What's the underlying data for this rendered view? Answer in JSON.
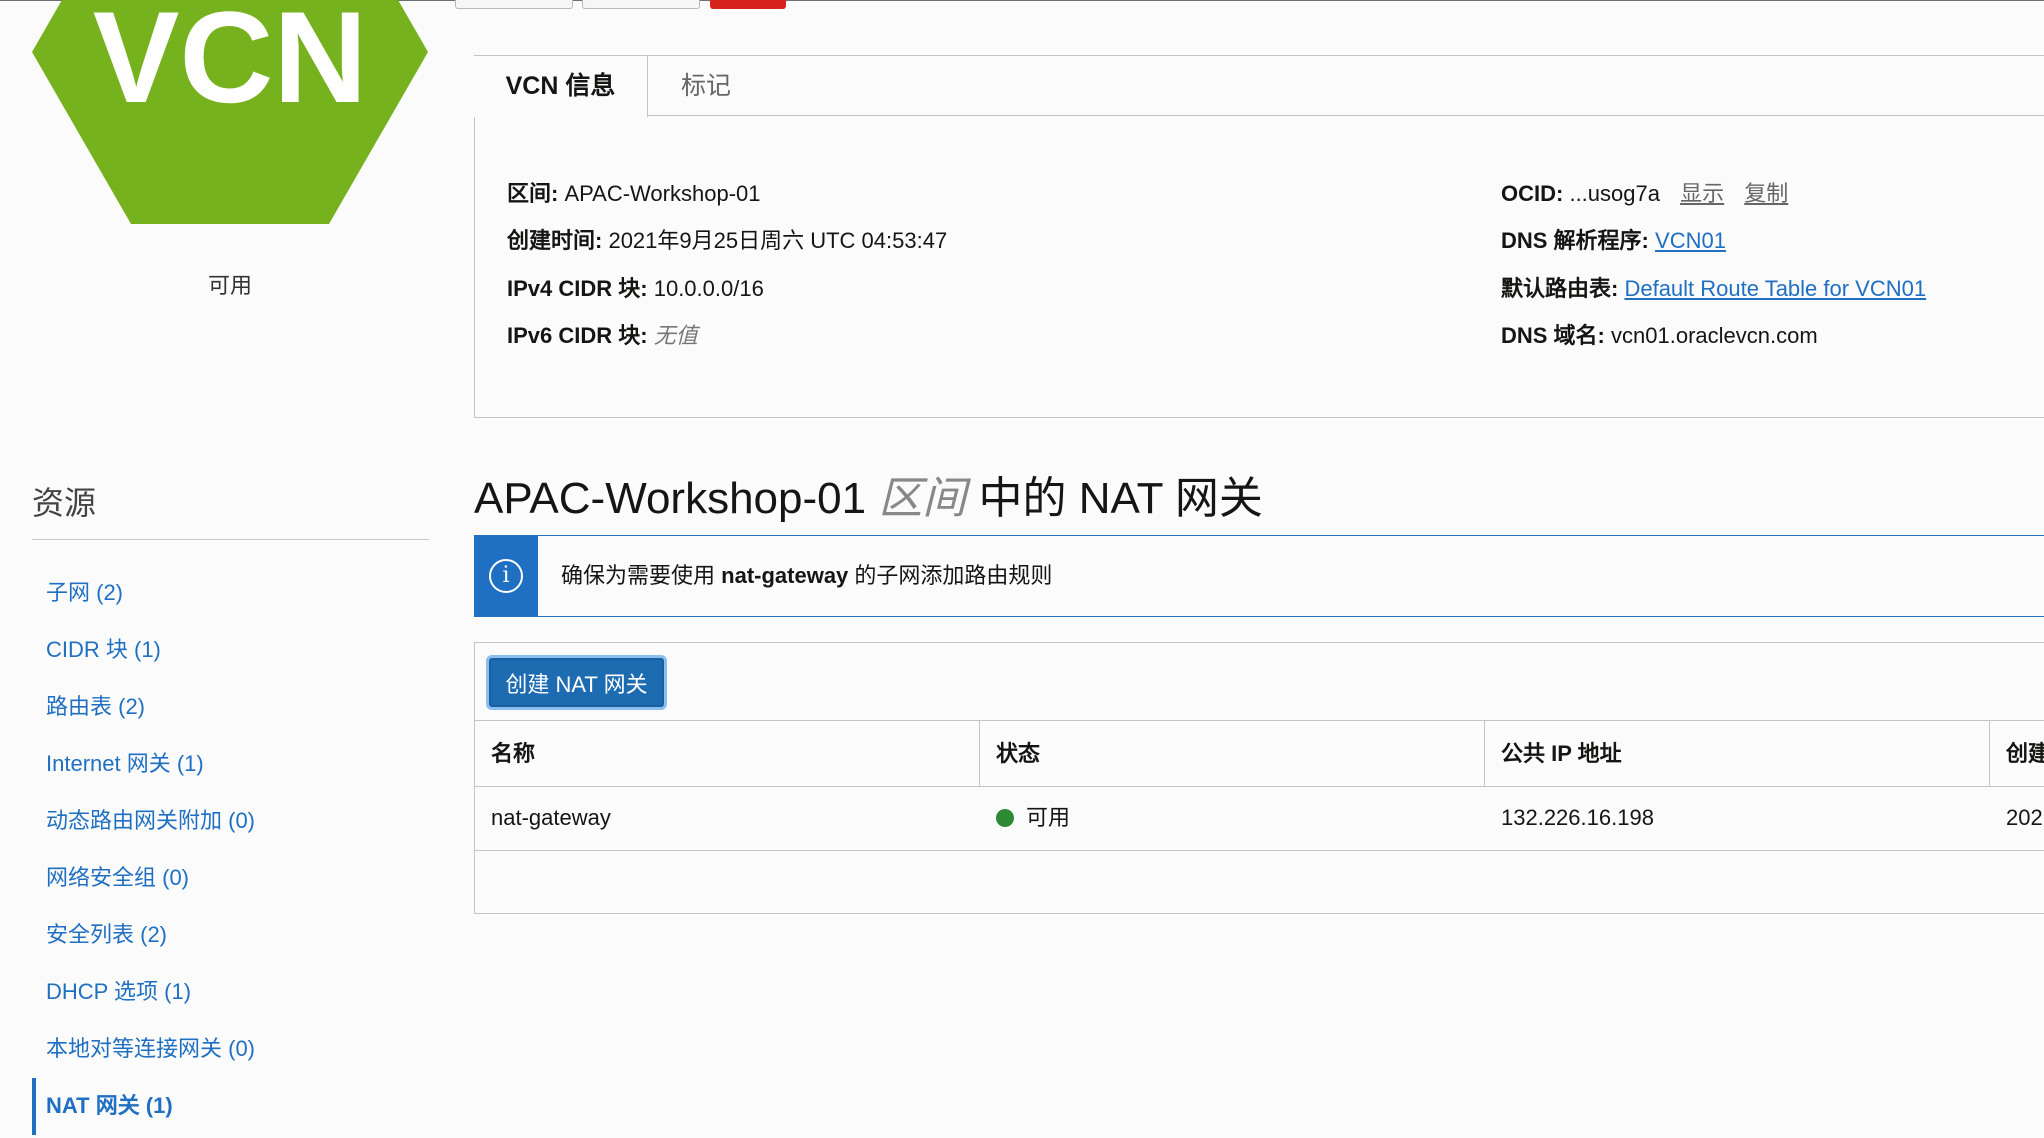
{
  "topbar": {
    "buttons": [
      "",
      "",
      ""
    ]
  },
  "vcn": {
    "icon_text": "VCN",
    "status": "可用",
    "colors": {
      "hex": "#76b21e",
      "accent": "#1f6fc2",
      "danger": "#d7231b",
      "ok": "#2d8a34"
    }
  },
  "resources": {
    "title": "资源",
    "items": [
      {
        "label": "子网 (2)"
      },
      {
        "label": "CIDR 块 (1)"
      },
      {
        "label": "路由表 (2)"
      },
      {
        "label": "Internet 网关 (1)"
      },
      {
        "label": "动态路由网关附加 (0)"
      },
      {
        "label": "网络安全组 (0)"
      },
      {
        "label": "安全列表 (2)"
      },
      {
        "label": "DHCP 选项 (1)"
      },
      {
        "label": "本地对等连接网关 (0)"
      },
      {
        "label": "NAT 网关 (1)"
      }
    ]
  },
  "info": {
    "tabs": [
      "VCN 信息",
      "标记"
    ],
    "left": {
      "compartment": {
        "label": "区间:",
        "value": "APAC-Workshop-01"
      },
      "created": {
        "label": "创建时间:",
        "value": "2021年9月25日周六 UTC 04:53:47"
      },
      "ipv4": {
        "label": "IPv4 CIDR 块:",
        "value": "10.0.0.0/16"
      },
      "ipv6": {
        "label": "IPv6 CIDR 块:",
        "value": "无值"
      }
    },
    "right": {
      "ocid": {
        "label": "OCID:",
        "value": "...usog7a",
        "show": "显示",
        "copy": "复制"
      },
      "dns_resolver": {
        "label": "DNS 解析程序:",
        "value": "VCN01"
      },
      "route_table": {
        "label": "默认路由表:",
        "value": "Default Route Table for VCN01"
      },
      "dns_domain": {
        "label": "DNS 域名:",
        "value": "vcn01.oraclevcn.com"
      }
    }
  },
  "section": {
    "prefix": "APAC-Workshop-01",
    "italic": "区间",
    "suffix": "中的 NAT 网关"
  },
  "notice": {
    "icon": "info-icon",
    "before": "确保为需要使用",
    "bold": "nat-gateway",
    "after": "的子网添加路由规则"
  },
  "table": {
    "create_button": "创建 NAT 网关",
    "headers": [
      "名称",
      "状态",
      "公共 IP 地址",
      "创建"
    ],
    "rows": [
      {
        "name": "nat-gateway",
        "state": "可用",
        "public_ip": "132.226.16.198",
        "created": "202"
      }
    ]
  }
}
